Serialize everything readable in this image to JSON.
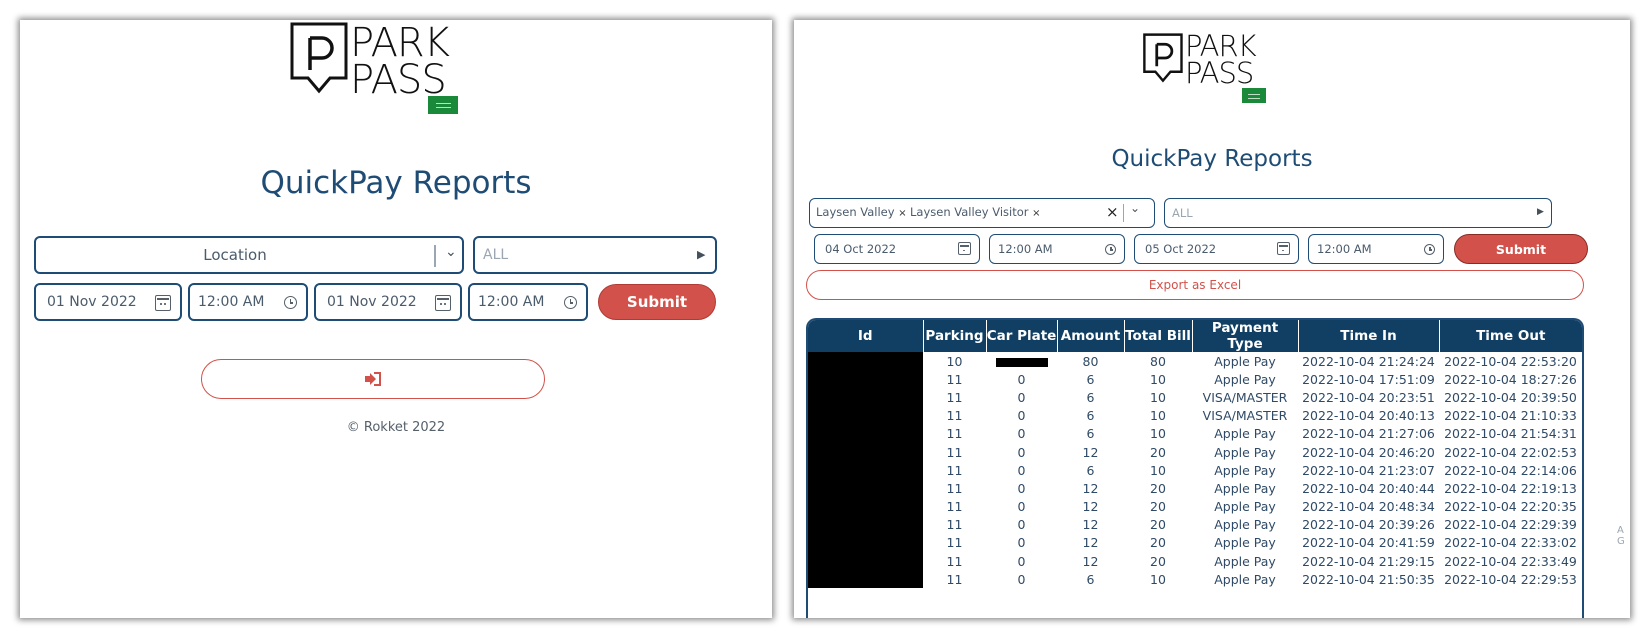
{
  "left_panel": {
    "brand": {
      "line1": "PARK",
      "line2": "PASS"
    },
    "title": "QuickPay Reports",
    "location_select": {
      "value": "Location"
    },
    "category_select": {
      "placeholder": "ALL"
    },
    "from_date": "01 Nov 2022",
    "from_time": "12:00 AM",
    "to_date": "01 Nov 2022",
    "to_time": "12:00 AM",
    "submit_label": "Submit",
    "footer": "© Rokket 2022"
  },
  "right_panel": {
    "brand": {
      "line1": "PARK",
      "line2": "PASS"
    },
    "title": "QuickPay Reports",
    "location_tags": [
      "Laysen Valley",
      "Laysen Valley Visitor"
    ],
    "category_select": {
      "placeholder": "ALL"
    },
    "from_date": "04 Oct 2022",
    "from_time": "12:00 AM",
    "to_date": "05 Oct 2022",
    "to_time": "12:00 AM",
    "submit_label": "Submit",
    "export_label": "Export as Excel",
    "table": {
      "columns": [
        "Id",
        "Parking",
        "Car Plate",
        "Amount",
        "Total Bill",
        "Payment Type",
        "Time In",
        "Time Out"
      ],
      "rows": [
        [
          "",
          "10",
          "",
          "80",
          "80",
          "Apple Pay",
          "2022-10-04 21:24:24",
          "2022-10-04 22:53:20"
        ],
        [
          "",
          "11",
          "0",
          "6",
          "10",
          "Apple Pay",
          "2022-10-04 17:51:09",
          "2022-10-04 18:27:26"
        ],
        [
          "",
          "11",
          "0",
          "6",
          "10",
          "VISA/MASTER",
          "2022-10-04 20:23:51",
          "2022-10-04 20:39:50"
        ],
        [
          "",
          "11",
          "0",
          "6",
          "10",
          "VISA/MASTER",
          "2022-10-04 20:40:13",
          "2022-10-04 21:10:33"
        ],
        [
          "",
          "11",
          "0",
          "6",
          "10",
          "Apple Pay",
          "2022-10-04 21:27:06",
          "2022-10-04 21:54:31"
        ],
        [
          "",
          "11",
          "0",
          "12",
          "20",
          "Apple Pay",
          "2022-10-04 20:46:20",
          "2022-10-04 22:02:53"
        ],
        [
          "",
          "11",
          "0",
          "6",
          "10",
          "Apple Pay",
          "2022-10-04 21:23:07",
          "2022-10-04 22:14:06"
        ],
        [
          "",
          "11",
          "0",
          "12",
          "20",
          "Apple Pay",
          "2022-10-04 20:40:44",
          "2022-10-04 22:19:13"
        ],
        [
          "",
          "11",
          "0",
          "12",
          "20",
          "Apple Pay",
          "2022-10-04 20:48:34",
          "2022-10-04 22:20:35"
        ],
        [
          "",
          "11",
          "0",
          "12",
          "20",
          "Apple Pay",
          "2022-10-04 20:39:26",
          "2022-10-04 22:29:39"
        ],
        [
          "",
          "11",
          "0",
          "12",
          "20",
          "Apple Pay",
          "2022-10-04 20:41:59",
          "2022-10-04 22:33:02"
        ],
        [
          "",
          "11",
          "0",
          "12",
          "20",
          "Apple Pay",
          "2022-10-04 21:29:15",
          "2022-10-04 22:33:49"
        ],
        [
          "",
          "11",
          "0",
          "6",
          "10",
          "Apple Pay",
          "2022-10-04 21:50:35",
          "2022-10-04 22:29:53"
        ]
      ]
    }
  },
  "icons": {
    "logo": "parkpass-pin-logo",
    "flag": "saudi-flag-icon",
    "calendar": "calendar-icon",
    "clock": "clock-icon",
    "logout": "logout-icon"
  },
  "colors": {
    "primary": "#1f4c75",
    "header": "#103f63",
    "accent": "#d2524b",
    "flag": "#1a8a3a"
  }
}
